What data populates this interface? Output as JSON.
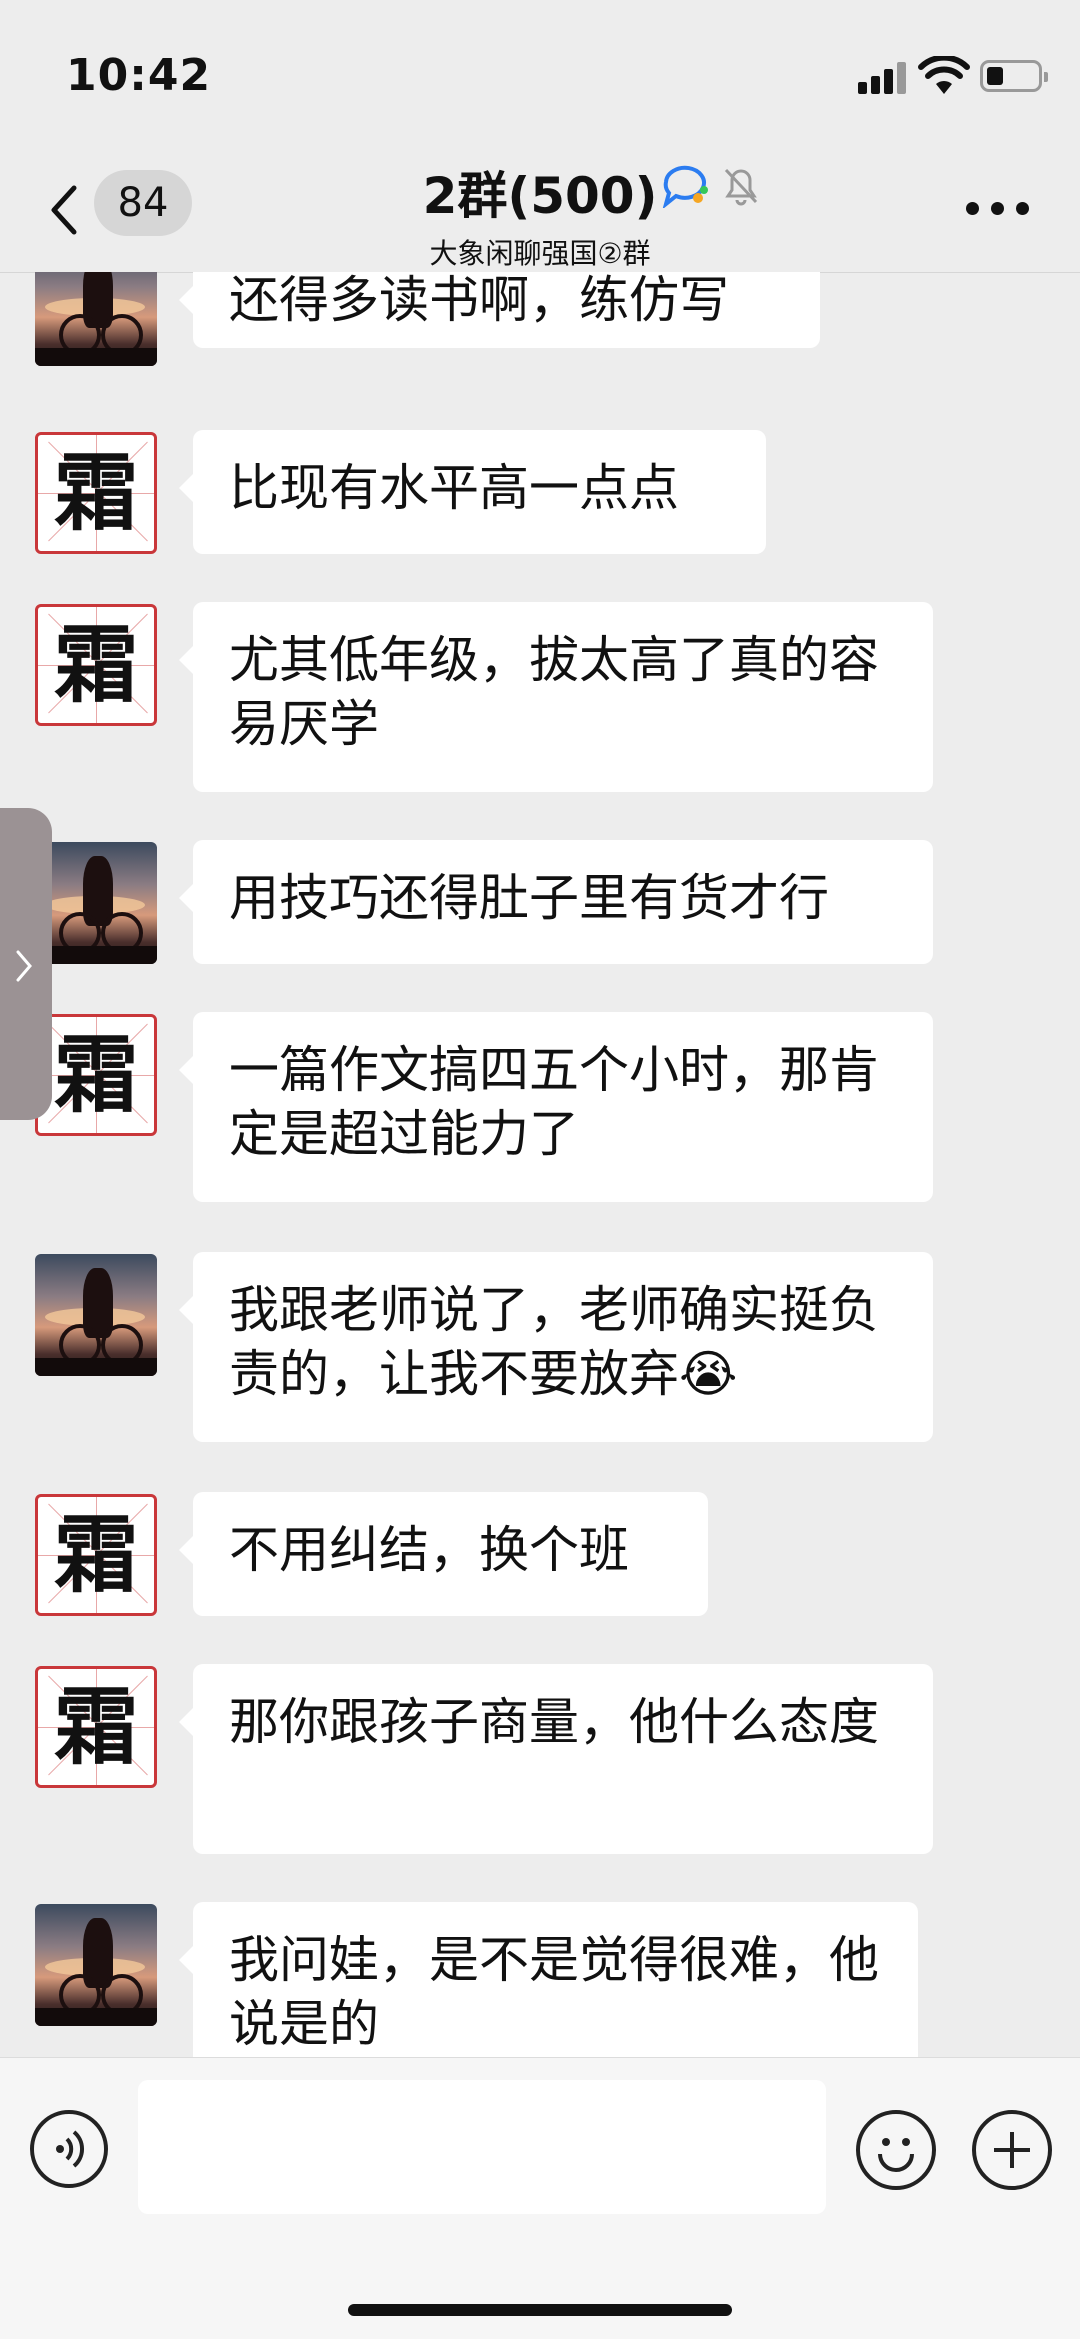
{
  "status": {
    "time": "10:42"
  },
  "header": {
    "unread_count": "84",
    "title": "2群(500)",
    "subtitle": "大象闲聊强国②群"
  },
  "avatars": {
    "frost_glyph": "霜"
  },
  "messages": [
    {
      "sender": "photo",
      "text": "还得多读书啊，练仿写"
    },
    {
      "sender": "frost",
      "text": "比现有水平高一点点"
    },
    {
      "sender": "frost",
      "text": "尤其低年级，拔太高了真的容易厌学"
    },
    {
      "sender": "photo",
      "text": "用技巧还得肚子里有货才行"
    },
    {
      "sender": "frost",
      "text": "一篇作文搞四五个小时，那肯定是超过能力了"
    },
    {
      "sender": "photo",
      "text": "我跟老师说了，老师确实挺负责的，让我不要放弃😭"
    },
    {
      "sender": "frost",
      "text": "不用纠结，换个班"
    },
    {
      "sender": "frost",
      "text": "那你跟孩子商量，他什么态度"
    },
    {
      "sender": "photo",
      "text": "我问娃，是不是觉得很难，他说是的"
    }
  ],
  "input": {
    "value": ""
  },
  "icons": [
    "back-icon",
    "chat-bubble-icon",
    "bell-muted-icon",
    "more-icon",
    "voice-icon",
    "emoji-icon",
    "plus-icon",
    "chevron-right-icon"
  ]
}
